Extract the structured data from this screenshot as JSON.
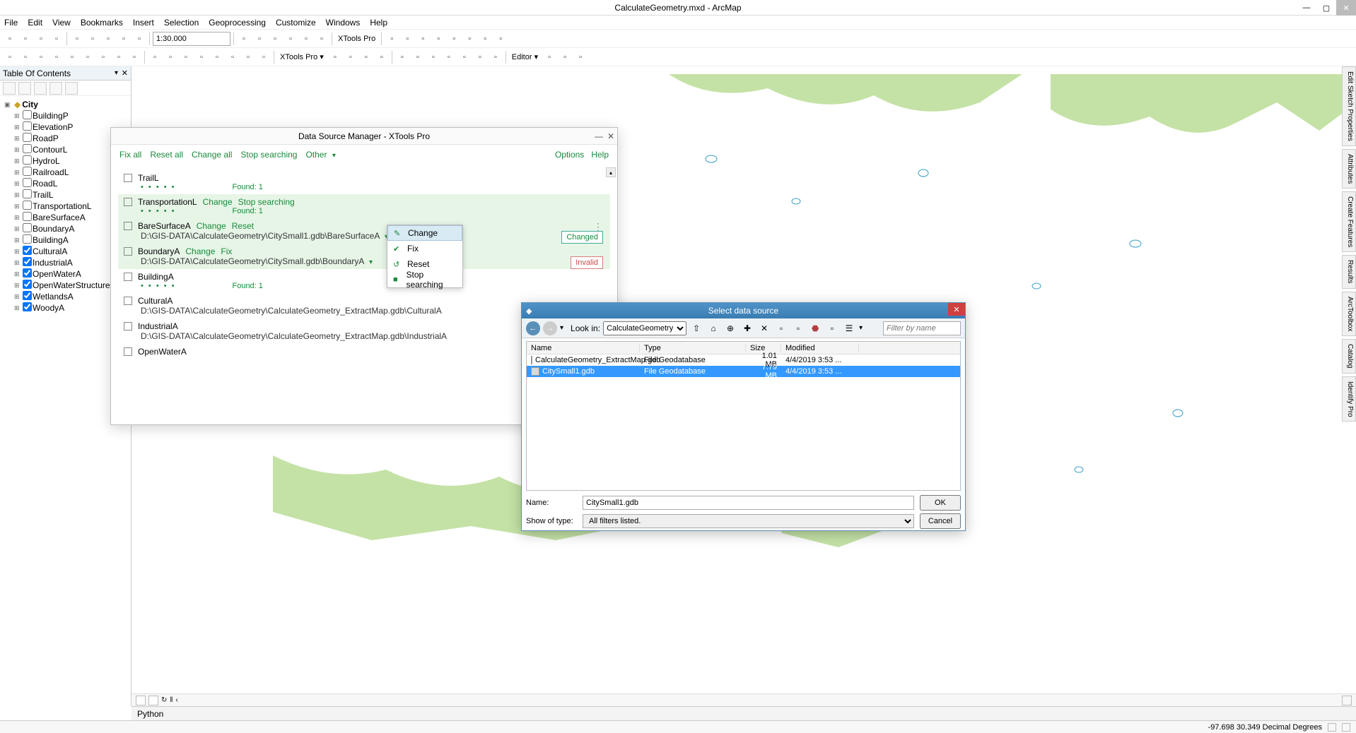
{
  "titlebar": {
    "title": "CalculateGeometry.mxd - ArcMap"
  },
  "menu": [
    "File",
    "Edit",
    "View",
    "Bookmarks",
    "Insert",
    "Selection",
    "Geoprocessing",
    "Customize",
    "Windows",
    "Help"
  ],
  "scale": "1:30.000",
  "toolbar_labels": {
    "xtools_top": "XTools Pro",
    "xtools_bottom": "XTools Pro ▾",
    "editor": "Editor ▾"
  },
  "toc": {
    "title": "Table Of Contents",
    "root": "City",
    "layers": [
      {
        "name": "BuildingP",
        "checked": false
      },
      {
        "name": "ElevationP",
        "checked": false
      },
      {
        "name": "RoadP",
        "checked": false
      },
      {
        "name": "ContourL",
        "checked": false
      },
      {
        "name": "HydroL",
        "checked": false
      },
      {
        "name": "RailroadL",
        "checked": false
      },
      {
        "name": "RoadL",
        "checked": false
      },
      {
        "name": "TrailL",
        "checked": false
      },
      {
        "name": "TransportationL",
        "checked": false
      },
      {
        "name": "BareSurfaceA",
        "checked": false
      },
      {
        "name": "BoundaryA",
        "checked": false
      },
      {
        "name": "BuildingA",
        "checked": false
      },
      {
        "name": "CulturalA",
        "checked": true
      },
      {
        "name": "IndustrialA",
        "checked": true
      },
      {
        "name": "OpenWaterA",
        "checked": true
      },
      {
        "name": "OpenWaterStructureA",
        "checked": true
      },
      {
        "name": "WetlandsA",
        "checked": true
      },
      {
        "name": "WoodyA",
        "checked": true
      }
    ]
  },
  "dsm": {
    "title": "Data Source Manager - XTools Pro",
    "actions": [
      "Fix all",
      "Reset all",
      "Change all",
      "Stop searching",
      "Other"
    ],
    "right_actions": [
      "Options",
      "Help"
    ],
    "found": "Found: 1",
    "dots": "• • • • •",
    "items": {
      "trail": {
        "name": "TrailL"
      },
      "transp": {
        "name": "TransportationL",
        "a1": "Change",
        "a2": "Stop searching"
      },
      "bare": {
        "name": "BareSurfaceA",
        "a1": "Change",
        "a2": "Reset",
        "path": "D:\\GIS-DATA\\CalculateGeometry\\CitySmall1.gdb\\BareSurfaceA",
        "badge": "Changed"
      },
      "boundary": {
        "name": "BoundaryA",
        "a1": "Change",
        "a2": "Fix",
        "path": "D:\\GIS-DATA\\CalculateGeometry\\CitySmall.gdb\\BoundaryA",
        "badge": "Invalid"
      },
      "building": {
        "name": "BuildingA"
      },
      "cultural": {
        "name": "CulturalA",
        "path": "D:\\GIS-DATA\\CalculateGeometry\\CalculateGeometry_ExtractMap.gdb\\CulturalA"
      },
      "industrial": {
        "name": "IndustrialA",
        "path": "D:\\GIS-DATA\\CalculateGeometry\\CalculateGeometry_ExtractMap.gdb\\IndustrialA"
      },
      "openwater": {
        "name": "OpenWaterA"
      }
    }
  },
  "ctx": {
    "change": "Change",
    "fix": "Fix",
    "reset": "Reset",
    "stop": "Stop searching"
  },
  "sds": {
    "title": "Select data source",
    "lookin_label": "Look in:",
    "lookin_value": "CalculateGeometry",
    "filter_placeholder": "Filter by name",
    "cols": {
      "name": "Name",
      "type": "Type",
      "size": "Size",
      "modified": "Modified"
    },
    "rows": [
      {
        "name": "CalculateGeometry_ExtractMap.gdb",
        "type": "File Geodatabase",
        "size": "1.01 MB",
        "modified": "4/4/2019 3:53 ..."
      },
      {
        "name": "CitySmall1.gdb",
        "type": "File Geodatabase",
        "size": "7.79 MB",
        "modified": "4/4/2019 3:53 ..."
      }
    ],
    "name_label": "Name:",
    "name_value": "CitySmall1.gdb",
    "type_label": "Show of type:",
    "type_value": "All filters listed.",
    "ok": "OK",
    "cancel": "Cancel"
  },
  "python_bar": "Python",
  "status": {
    "coords": "-97.698 30.349 Decimal Degrees"
  },
  "side_tabs": [
    "Edit Sketch Properties",
    "Attributes",
    "Create Features",
    "Results",
    "ArcToolbox",
    "Catalog",
    "Identify Pro"
  ]
}
